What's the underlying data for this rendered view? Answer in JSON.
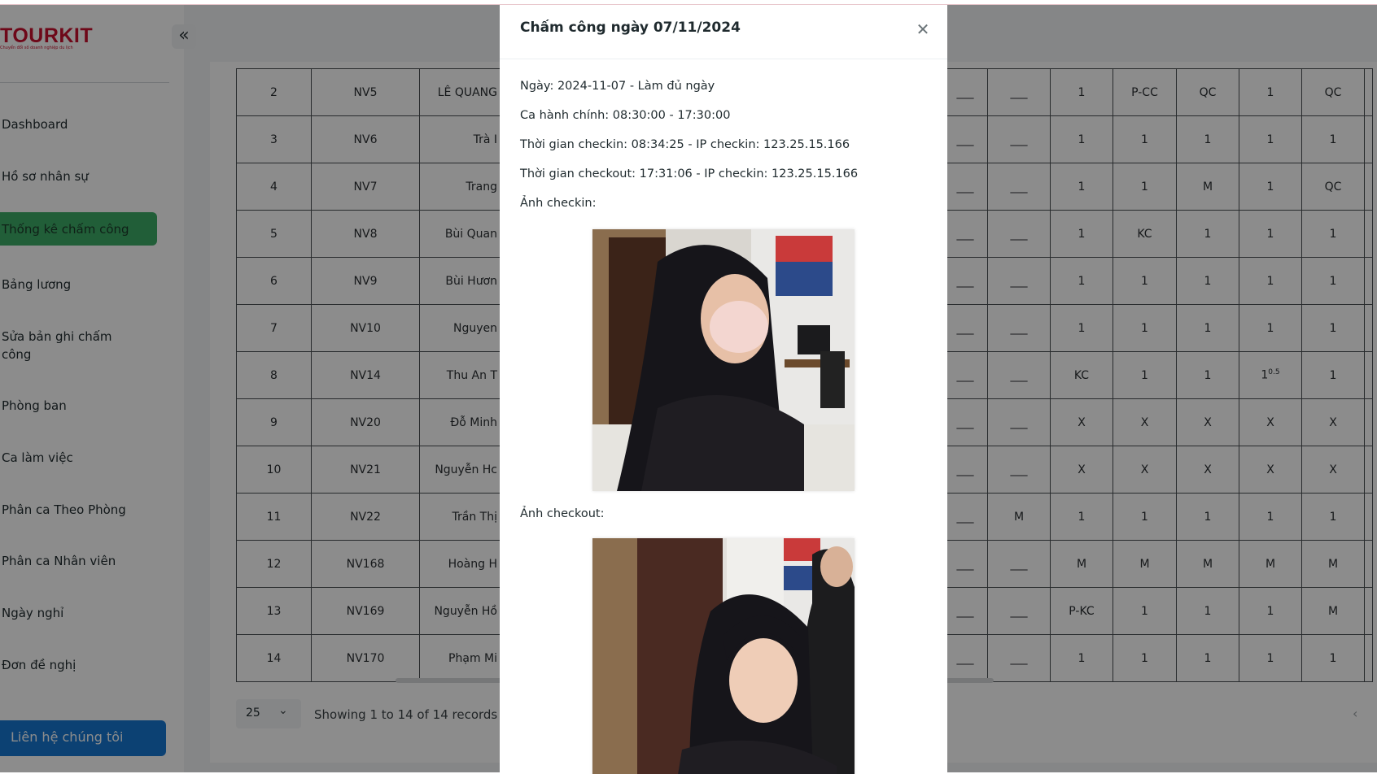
{
  "sidebar": {
    "logo": "TOURKIT",
    "logo_sub": "Chuyển đổi số doanh nghiệp du lịch",
    "items": [
      {
        "label": "Dashboard"
      },
      {
        "label": "Hồ sơ nhân sự"
      },
      {
        "label": "Thống kê chấm công",
        "active": true
      },
      {
        "label": "Bảng lương"
      },
      {
        "label": "Sửa bản ghi chấm"
      },
      {
        "label": "Phòng ban"
      },
      {
        "label": "Ca làm việc"
      },
      {
        "label": "Phân ca Theo Phòng"
      },
      {
        "label": "Phân ca Nhân viên"
      },
      {
        "label": "Ngày nghỉ"
      },
      {
        "label": "Đơn đề nghị"
      }
    ],
    "item4_line2": "công",
    "contact": "Liên hệ chúng tôi",
    "active_color": "#3cab67",
    "contact_color": "#1677d2",
    "brand_color": "#c8102e"
  },
  "table": {
    "rows": [
      {
        "stt": "2",
        "code": "NV5",
        "name": "LÊ QUANG",
        "c1": "___",
        "c2": "___",
        "d1": "1",
        "d2": "P-CC",
        "d3": "QC",
        "d4": "1",
        "d5": "QC"
      },
      {
        "stt": "3",
        "code": "NV6",
        "name": "Trà I",
        "c1": "___",
        "c2": "___",
        "d1": "1",
        "d2": "1",
        "d3": "1",
        "d4": "1",
        "d5": "1"
      },
      {
        "stt": "4",
        "code": "NV7",
        "name": "Trang",
        "c1": "___",
        "c2": "___",
        "d1": "1",
        "d2": "1",
        "d3": "M",
        "d4": "1",
        "d5": "QC"
      },
      {
        "stt": "5",
        "code": "NV8",
        "name": "Bùi Quan",
        "c1": "___",
        "c2": "___",
        "d1": "1",
        "d2": "KC",
        "d3": "1",
        "d4": "1",
        "d5": "1"
      },
      {
        "stt": "6",
        "code": "NV9",
        "name": "Bùi Hươn",
        "c1": "___",
        "c2": "___",
        "d1": "1",
        "d2": "1",
        "d3": "1",
        "d4": "1",
        "d5": "1"
      },
      {
        "stt": "7",
        "code": "NV10",
        "name": "Nguyen",
        "c1": "___",
        "c2": "___",
        "d1": "1",
        "d2": "1",
        "d3": "1",
        "d4": "1",
        "d5": "1"
      },
      {
        "stt": "8",
        "code": "NV14",
        "name": "Thu An T",
        "c1": "___",
        "c2": "___",
        "d1": "KC",
        "d2": "1",
        "d3": "1",
        "d4": "1",
        "d4_sup": "0.5",
        "d5": "1"
      },
      {
        "stt": "9",
        "code": "NV20",
        "name": "Đỗ Minh",
        "c1": "___",
        "c2": "___",
        "d1": "X",
        "d2": "X",
        "d3": "X",
        "d4": "X",
        "d5": "X"
      },
      {
        "stt": "10",
        "code": "NV21",
        "name": "Nguyễn Hc",
        "c1": "___",
        "c2": "___",
        "d1": "X",
        "d2": "X",
        "d3": "X",
        "d4": "X",
        "d5": "X"
      },
      {
        "stt": "11",
        "code": "NV22",
        "name": "Trần Thị",
        "c1": "___",
        "c2": "M",
        "d1": "1",
        "d2": "1",
        "d3": "1",
        "d4": "1",
        "d5": "1"
      },
      {
        "stt": "12",
        "code": "NV168",
        "name": "Hoàng H",
        "c1": "___",
        "c2": "___",
        "d1": "M",
        "d2": "M",
        "d3": "M",
        "d4": "M",
        "d5": "M"
      },
      {
        "stt": "13",
        "code": "NV169",
        "name": "Nguyễn Hồ",
        "c1": "___",
        "c2": "___",
        "d1": "P-KC",
        "d2": "1",
        "d3": "1",
        "d4": "1",
        "d5": "M"
      },
      {
        "stt": "14",
        "code": "NV170",
        "name": "Phạm Mi",
        "c1": "___",
        "c2": "___",
        "d1": "1",
        "d2": "1",
        "d3": "1",
        "d4": "1",
        "d5": "1"
      }
    ]
  },
  "pagination": {
    "page_size": "25",
    "records": "Showing 1 to 14 of 14 records"
  },
  "modal": {
    "title": "Chấm công ngày 07/11/2024",
    "date_line": "Ngày: 2024-11-07 - Làm đủ ngày",
    "shift_line": "Ca hành chính: 08:30:00 - 17:30:00",
    "checkin_line": "Thời gian checkin: 08:34:25 - IP checkin: 123.25.15.166",
    "checkout_line": "Thời gian checkout: 17:31:06 - IP checkin: 123.25.15.166",
    "checkin_photo_label": "Ảnh checkin:",
    "checkout_photo_label": "Ảnh checkout:"
  },
  "icons": {
    "collapse": "double-chevron-left-icon",
    "close": "close-icon",
    "select": "chevron-down-icon",
    "prev": "chevron-left-icon"
  }
}
